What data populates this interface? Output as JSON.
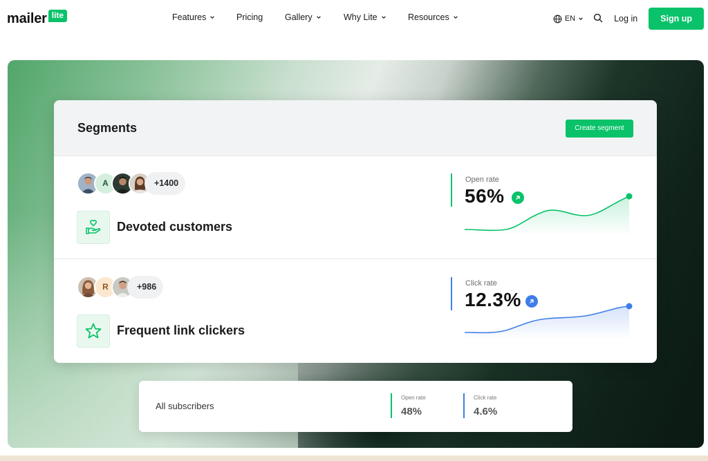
{
  "nav": {
    "logo_text": "mailer",
    "logo_badge": "lite",
    "items": [
      {
        "label": "Features",
        "has_dropdown": true
      },
      {
        "label": "Pricing",
        "has_dropdown": false
      },
      {
        "label": "Gallery",
        "has_dropdown": true
      },
      {
        "label": "Why Lite",
        "has_dropdown": true
      },
      {
        "label": "Resources",
        "has_dropdown": true
      }
    ],
    "language": "EN",
    "login_label": "Log in",
    "signup_label": "Sign up"
  },
  "segments_card": {
    "title": "Segments",
    "create_button": "Create segment",
    "rows": [
      {
        "name": "Devoted customers",
        "avatar_initial": "A",
        "count": "+1400",
        "metric_label": "Open rate",
        "metric_value": "56%",
        "accent": "#09c269"
      },
      {
        "name": "Frequent link clickers",
        "avatar_initial": "R",
        "count": "+986",
        "metric_label": "Click rate",
        "metric_value": "12.3%",
        "accent": "#3f7ee8"
      }
    ]
  },
  "all_subscribers": {
    "label": "All subscribers",
    "open_rate_label": "Open rate",
    "open_rate_value": "48%",
    "click_rate_label": "Click rate",
    "click_rate_value": "4.6%"
  },
  "colors": {
    "brand": "#09c269",
    "blue": "#3f7ee8"
  }
}
